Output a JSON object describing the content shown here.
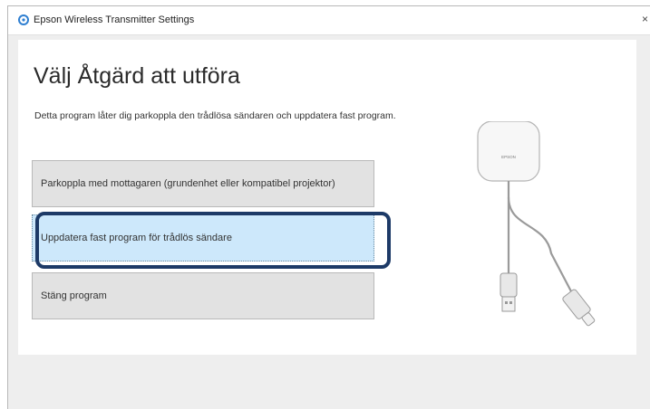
{
  "window": {
    "title": "Epson Wireless Transmitter Settings",
    "close_glyph": "×"
  },
  "main": {
    "heading": "Välj Åtgärd att utföra",
    "description": "Detta program låter dig parkoppla den trådlösa sändaren och uppdatera fast program."
  },
  "options": [
    {
      "label": "Parkoppla med mottagaren (grundenhet eller kompatibel projektor)"
    },
    {
      "label": "Uppdatera fast program för trådlös sändare",
      "selected": true
    },
    {
      "label": "Stäng program"
    }
  ],
  "illustration": {
    "brand_text": "EPSON"
  },
  "colors": {
    "selected_option_bg": "#cde8fb",
    "highlight_ring": "#1d3a67",
    "app_icon": "#2f7fd1"
  },
  "icons": [
    "app-icon",
    "close-icon"
  ]
}
